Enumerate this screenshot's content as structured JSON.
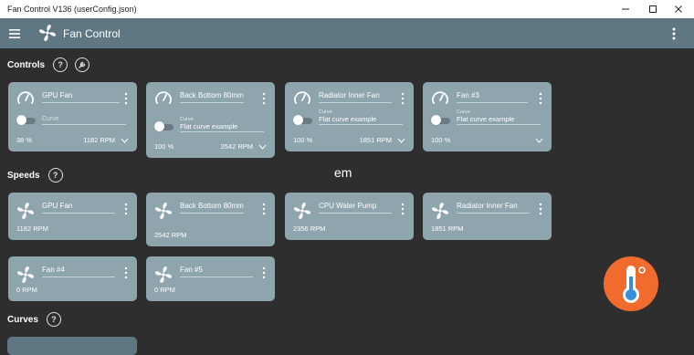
{
  "window": {
    "title": "Fan Control V136 (userConfig.json)"
  },
  "appbar": {
    "title": "Fan Control"
  },
  "sections": {
    "controls": "Controls",
    "speeds": "Speeds",
    "curves": "Curves",
    "help_symbol": "?"
  },
  "controls": [
    {
      "name": "GPU Fan",
      "curve_label": "",
      "curve_value": "Curve",
      "percent": "38 %",
      "rpm": "1182 RPM",
      "enabled": false
    },
    {
      "name": "Back Bottom 80mm",
      "curve_label": "Curve",
      "curve_value": "Flat curve example",
      "percent": "100 %",
      "rpm": "2542 RPM",
      "enabled": false
    },
    {
      "name": "Radiator Inner Fan",
      "curve_label": "Curve",
      "curve_value": "Flat curve example",
      "percent": "100 %",
      "rpm": "1851 RPM",
      "enabled": false
    },
    {
      "name": "Fan #3",
      "curve_label": "Curve",
      "curve_value": "Flat curve example",
      "percent": "100 %",
      "rpm": "",
      "enabled": false
    }
  ],
  "speeds": [
    {
      "name": "GPU Fan",
      "value": "1182 RPM"
    },
    {
      "name": "Back Bottom 80mm",
      "value": "2542 RPM"
    },
    {
      "name": "CPU Water Pump",
      "value": "2356 RPM"
    },
    {
      "name": "Radiator Inner Fan",
      "value": "1851 RPM"
    },
    {
      "name": "Fan #4",
      "value": "0 RPM"
    },
    {
      "name": "Fan #5",
      "value": "0 RPM"
    }
  ],
  "overlay_text": "em",
  "colors": {
    "appbar": "#5f7783",
    "card": "#8fa5ae",
    "background": "#2e2e2e",
    "thermometer_badge": "#f26b2e"
  },
  "icons": {
    "menu": "hamburger-icon",
    "logo": "fan-icon",
    "gauge": "gauge-icon",
    "fan": "fan-icon",
    "wrench": "wrench-icon",
    "badge": "thermometer-icon"
  }
}
